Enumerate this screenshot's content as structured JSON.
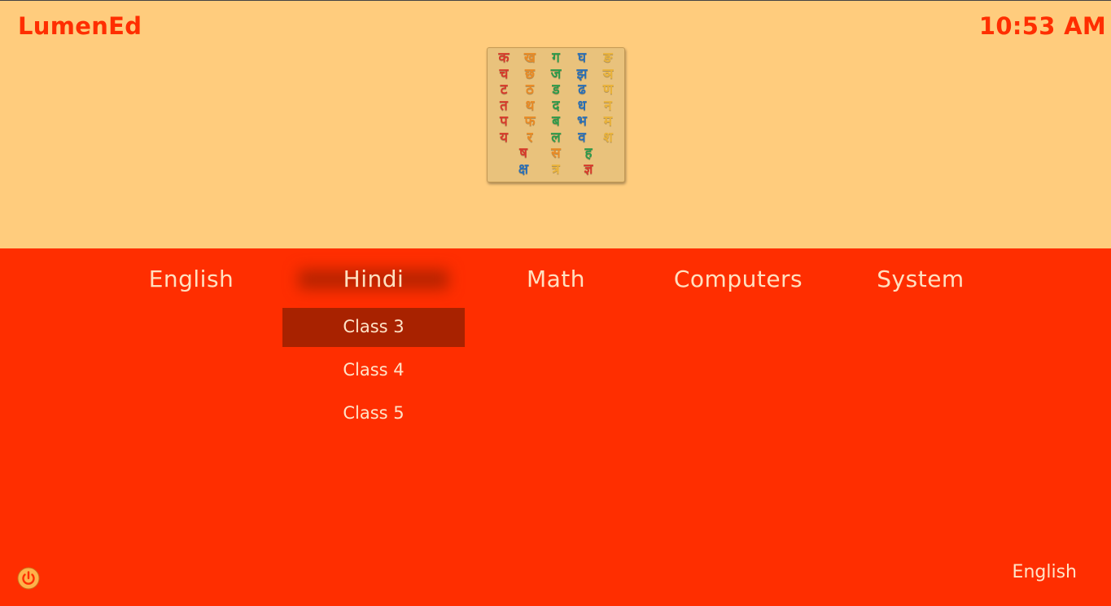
{
  "app": {
    "brand": "LumenEd",
    "clock": "10:53 AM"
  },
  "header_image": {
    "rows": [
      [
        "क",
        "ख",
        "ग",
        "घ",
        "ङ"
      ],
      [
        "च",
        "छ",
        "ज",
        "झ",
        "ञ"
      ],
      [
        "ट",
        "ठ",
        "ड",
        "ढ",
        "ण"
      ],
      [
        "त",
        "थ",
        "द",
        "ध",
        "न"
      ],
      [
        "प",
        "फ",
        "ब",
        "भ",
        "म"
      ],
      [
        "य",
        "र",
        "ल",
        "व",
        "श"
      ],
      [
        "ष",
        "स",
        "ह"
      ],
      [
        "क्ष",
        "त्र",
        "ज्ञ"
      ]
    ],
    "colors": [
      "#d63a2b",
      "#e88a25",
      "#2e9a4a",
      "#2a6fb5",
      "#e9b23a"
    ]
  },
  "nav": {
    "tabs": [
      {
        "label": "English"
      },
      {
        "label": "Hindi",
        "active": true
      },
      {
        "label": "Math"
      },
      {
        "label": "Computers"
      },
      {
        "label": "System"
      }
    ]
  },
  "submenu": {
    "items": [
      {
        "label": "Class 3",
        "selected": true
      },
      {
        "label": "Class 4"
      },
      {
        "label": "Class 5"
      }
    ]
  },
  "footer": {
    "power_icon": "power-icon",
    "language": "English"
  },
  "theme": {
    "accent": "#ff2e00",
    "header_bg": "#ffcc7d",
    "selected_bg": "#a82200"
  }
}
